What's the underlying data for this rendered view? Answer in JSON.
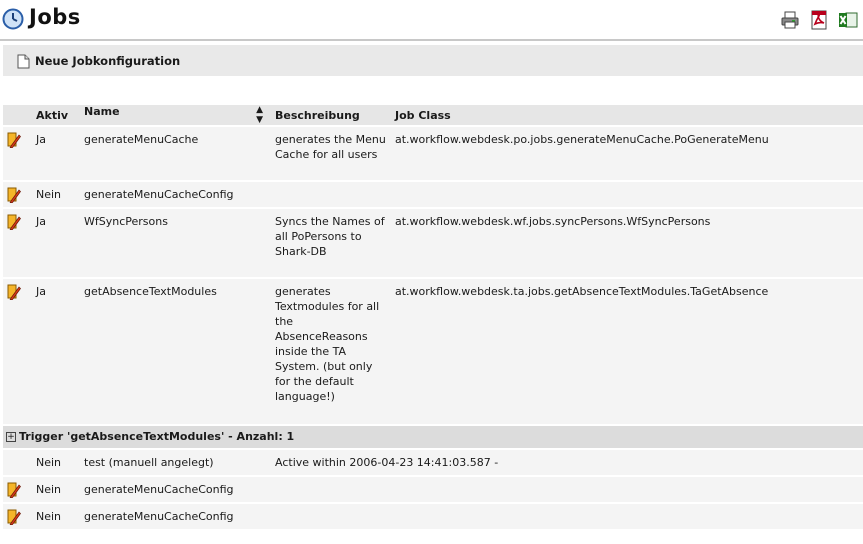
{
  "page": {
    "title": "Jobs"
  },
  "toolbar": {
    "new_config": "Neue Jobkonfiguration"
  },
  "table": {
    "columns": {
      "aktiv": "Aktiv",
      "name": "Name",
      "beschreibung": "Beschreibung",
      "job_class": "Job Class"
    },
    "rows": [
      {
        "aktiv": "Ja",
        "name": "generateMenuCache",
        "beschreibung": "generates the Menu Cache for all users",
        "job_class": "at.workflow.webdesk.po.jobs.generateMenuCache.PoGenerateMenu"
      },
      {
        "aktiv": "Nein",
        "name": "generateMenuCacheConfig",
        "beschreibung": "",
        "job_class": ""
      },
      {
        "aktiv": "Ja",
        "name": "WfSyncPersons",
        "beschreibung": "Syncs the Names of all PoPersons to Shark-DB",
        "job_class": "at.workflow.webdesk.wf.jobs.syncPersons.WfSyncPersons"
      },
      {
        "aktiv": "Ja",
        "name": "getAbsenceTextModules",
        "beschreibung": "generates Textmodules for all the AbsenceReasons inside the TA System. (but only for the default language!)",
        "job_class": "at.workflow.webdesk.ta.jobs.getAbsenceTextModules.TaGetAbsence"
      }
    ],
    "trigger": {
      "label": "Trigger 'getAbsenceTextModules' - Anzahl: 1",
      "rows": [
        {
          "aktiv": "Nein",
          "name": "test (manuell angelegt)",
          "info": "Active within 2006-04-23 14:41:03.587 -"
        }
      ]
    },
    "extra_rows": [
      {
        "aktiv": "Nein",
        "name": "generateMenuCacheConfig"
      },
      {
        "aktiv": "Nein",
        "name": "generateMenuCacheConfig"
      }
    ]
  }
}
